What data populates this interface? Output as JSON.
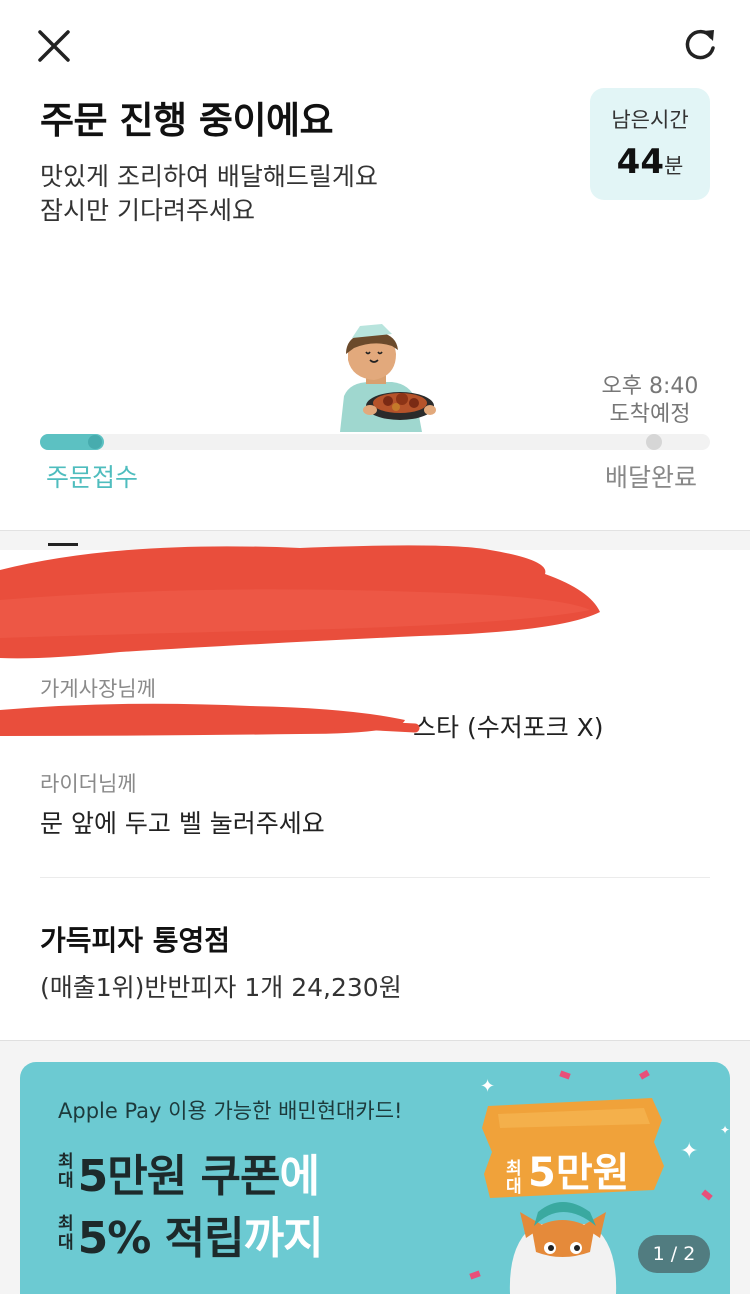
{
  "header": {
    "title": "주문 진행 중이에요",
    "subtitle_line1": "맛있게 조리하여 배달해드릴게요",
    "subtitle_line2": "잠시만 기다려주세요",
    "remaining_label": "남은시간",
    "remaining_value": "44",
    "remaining_unit": "분"
  },
  "progress": {
    "eta_time": "오후 8:40",
    "eta_label": "도착예정",
    "step_start": "주문접수",
    "step_end": "배달완료",
    "fraction": 0.07
  },
  "requests": {
    "owner_label": "가게사장님께",
    "owner_text_visible": "스타 (수저포크 X)",
    "rider_label": "라이더님께",
    "rider_text": "문 앞에 두고 벨 눌러주세요"
  },
  "order": {
    "store_name": "가득피자 통영점",
    "item": "(매출1위)반반피자 1개 24,230원"
  },
  "banner": {
    "subtitle": "Apple Pay 이용 가능한 배민현대카드!",
    "line1_mini": [
      "최",
      "대"
    ],
    "line1_main": "5만원 쿠폰",
    "line1_accent": "에",
    "line2_mini": [
      "최",
      "대"
    ],
    "line2_main": "5% 적립",
    "line2_accent": "까지",
    "sign_mini": [
      "최",
      "대"
    ],
    "sign_main": "5만원",
    "page_indicator": "1 / 2"
  },
  "colors": {
    "accent": "#5cc1c2",
    "time_box_bg": "#e2f5f6",
    "banner_bg": "#6ccad2",
    "redaction": "#e94e3c"
  }
}
